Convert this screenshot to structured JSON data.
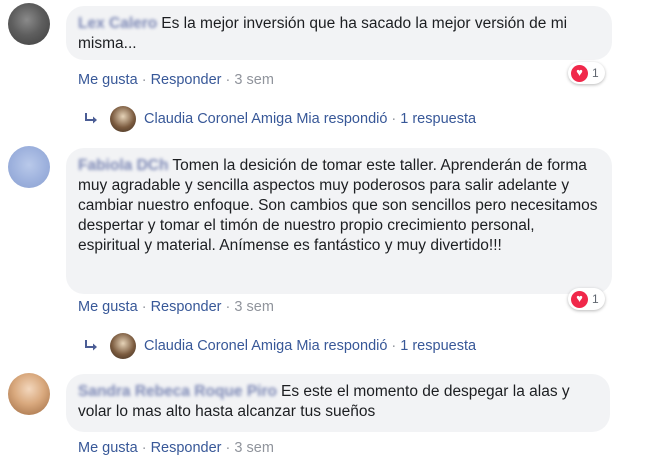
{
  "comments": [
    {
      "author": "Lex Calero",
      "text": "Es la mejor inversión que ha sacado la mejor versión de mi misma...",
      "actions": {
        "like": "Me gusta",
        "reply": "Responder",
        "time": "3 sem"
      },
      "reaction_count": "1"
    },
    {
      "author": "Fabiola DCh",
      "text": "Tomen la desición de tomar este taller. Aprenderán de forma muy agradable y sencilla aspectos muy poderosos para salir adelante y cambiar nuestro enfoque. Son cambios que son sencillos pero necesitamos despertar y tomar el timón de nuestro propio crecimiento personal, espiritual y material. Anímense es fantástico y muy divertido!!!",
      "actions": {
        "like": "Me gusta",
        "reply": "Responder",
        "time": "3 sem"
      },
      "reaction_count": "1"
    },
    {
      "author": "Sandra Rebeca Roque Piro",
      "text": "Es este el momento de despegar la alas y volar lo mas alto hasta alcanzar tus sueños",
      "actions": {
        "like": "Me gusta",
        "reply": "Responder",
        "time": "3 sem"
      }
    }
  ],
  "replies": [
    {
      "text": "Claudia Coronel Amiga Mia respondió",
      "count": "1 respuesta"
    },
    {
      "text": "Claudia Coronel Amiga Mia respondió",
      "count": "1 respuesta"
    }
  ],
  "separator": "·",
  "colors": {
    "link": "#385898",
    "bubble": "#f2f3f5",
    "heart": "#f0284a",
    "meta": "#90949c"
  }
}
